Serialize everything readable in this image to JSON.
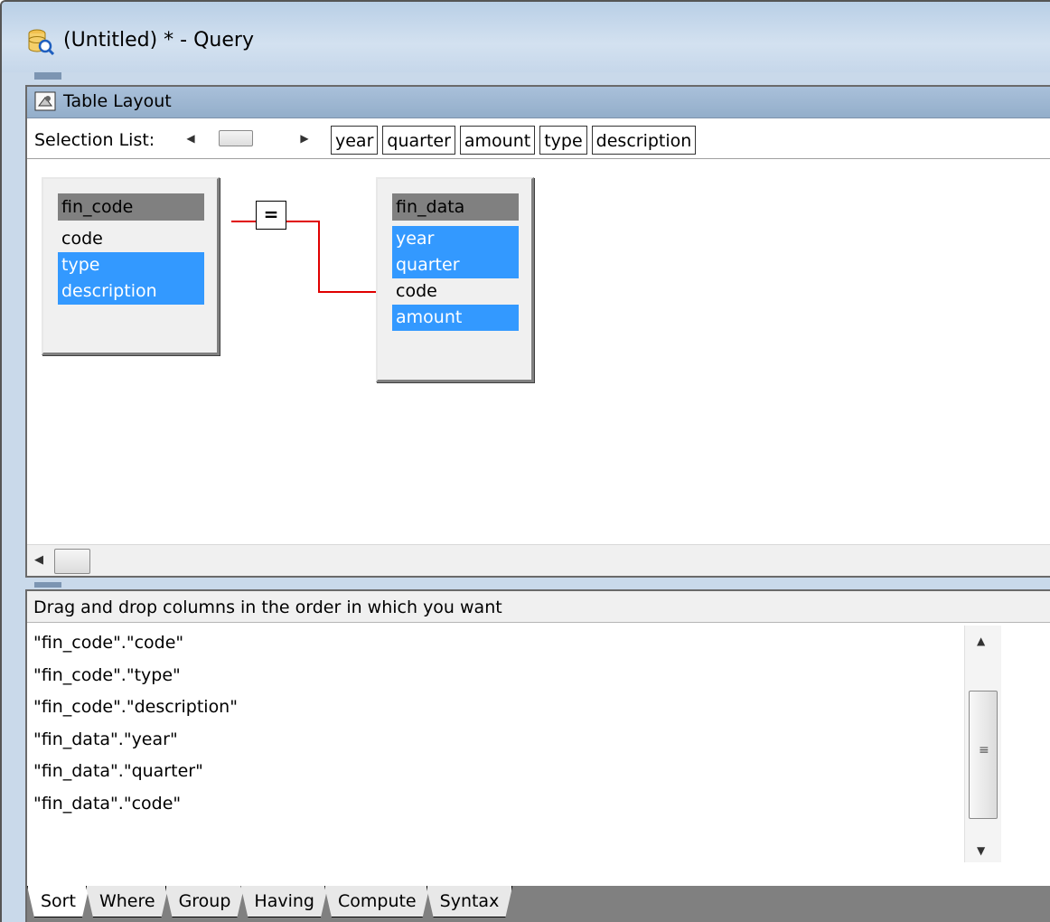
{
  "window": {
    "title": "(Untitled) * - Query"
  },
  "table_layout": {
    "title": "Table Layout",
    "selection_label": "Selection List:",
    "selection_items": [
      "year",
      "quarter",
      "amount",
      "type",
      "description"
    ]
  },
  "tables": [
    {
      "name": "fin_code",
      "columns": [
        {
          "label": "code",
          "selected": false
        },
        {
          "label": "type",
          "selected": true
        },
        {
          "label": "description",
          "selected": true
        }
      ]
    },
    {
      "name": "fin_data",
      "columns": [
        {
          "label": "year",
          "selected": true
        },
        {
          "label": "quarter",
          "selected": true
        },
        {
          "label": "code",
          "selected": false
        },
        {
          "label": "amount",
          "selected": true
        }
      ]
    }
  ],
  "join": {
    "operator": "="
  },
  "lower": {
    "instruction": "Drag and drop columns in the order in which you want",
    "sort_columns": [
      "\"fin_code\".\"code\"",
      "\"fin_code\".\"type\"",
      "\"fin_code\".\"description\"",
      "\"fin_data\".\"year\"",
      "\"fin_data\".\"quarter\"",
      "\"fin_data\".\"code\""
    ],
    "tabs": [
      "Sort",
      "Where",
      "Group",
      "Having",
      "Compute",
      "Syntax"
    ],
    "active_tab": "Sort"
  },
  "colors": {
    "selected_bg": "#3399ff",
    "join_line": "#e00000",
    "header_gray": "#808080"
  }
}
